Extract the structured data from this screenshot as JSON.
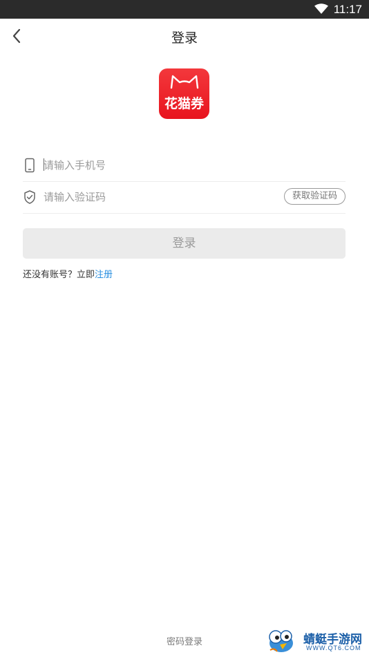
{
  "status_bar": {
    "time": "11:17",
    "icons": [
      "wifi-icon"
    ]
  },
  "nav": {
    "title": "登录",
    "back_icon": "chevron-left-icon"
  },
  "logo": {
    "text": "花猫券",
    "icon": "cat-ears-icon",
    "color": "#e8141e"
  },
  "form": {
    "phone": {
      "placeholder": "请输入手机号",
      "value": "",
      "icon": "phone-icon"
    },
    "code": {
      "placeholder": "请输入验证码",
      "value": "",
      "icon": "shield-check-icon",
      "get_code_label": "获取验证码"
    }
  },
  "login_button": {
    "label": "登录"
  },
  "register": {
    "prompt": "还没有账号？立即",
    "link": "注册",
    "link_color": "#2a8fe0"
  },
  "footer": {
    "password_login": "密码登录"
  },
  "watermark": {
    "title": "蜻蜓手游网",
    "url": "WWW.QT6.COM"
  }
}
